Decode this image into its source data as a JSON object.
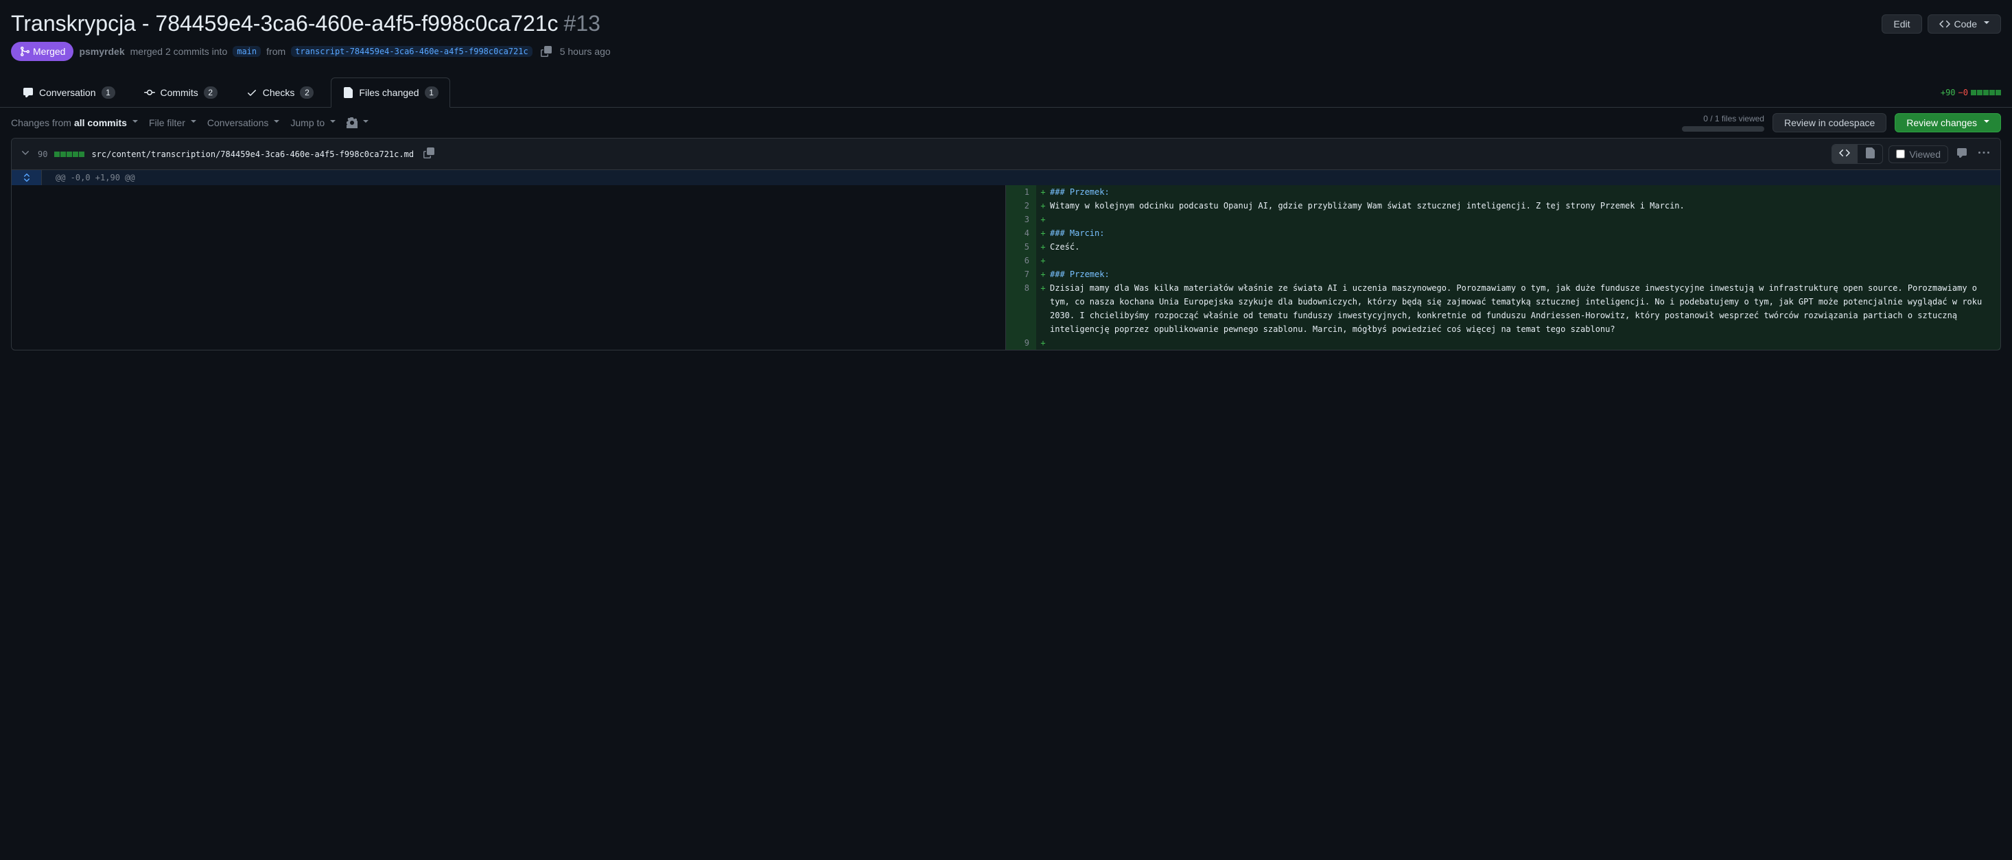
{
  "pr": {
    "title": "Transkrypcja - 784459e4-3ca6-460e-a4f5-f998c0ca721c",
    "number": "#13",
    "state": "Merged",
    "author": "psmyrdek",
    "merge_text_1": "merged 2 commits into",
    "base_branch": "main",
    "merge_text_2": "from",
    "head_branch": "transcript-784459e4-3ca6-460e-a4f5-f998c0ca721c",
    "time_ago": "5 hours ago"
  },
  "actions": {
    "edit": "Edit",
    "code": "Code"
  },
  "tabs": {
    "conversation": {
      "label": "Conversation",
      "count": "1"
    },
    "commits": {
      "label": "Commits",
      "count": "2"
    },
    "checks": {
      "label": "Checks",
      "count": "2"
    },
    "files_changed": {
      "label": "Files changed",
      "count": "1"
    }
  },
  "diffstat": {
    "add": "+90",
    "del": "−0"
  },
  "toolbar": {
    "changes_from_prefix": "Changes from",
    "changes_from_value": "all commits",
    "file_filter": "File filter",
    "conversations": "Conversations",
    "jump_to": "Jump to",
    "progress": "0 / 1 files viewed",
    "review_codespace": "Review in codespace",
    "review_changes": "Review changes"
  },
  "file": {
    "changed_lines": "90",
    "path": "src/content/transcription/784459e4-3ca6-460e-a4f5-f998c0ca721c.md",
    "viewed_label": "Viewed",
    "hunk": "@@ -0,0 +1,90 @@"
  },
  "diff_lines": [
    {
      "n": "1",
      "t": "### Przemek:",
      "heading": true
    },
    {
      "n": "2",
      "t": "Witamy w kolejnym odcinku podcastu Opanuj AI, gdzie przybliżamy Wam świat sztucznej inteligencji. Z tej strony Przemek i Marcin."
    },
    {
      "n": "3",
      "t": ""
    },
    {
      "n": "4",
      "t": "### Marcin:",
      "heading": true
    },
    {
      "n": "5",
      "t": "Cześć."
    },
    {
      "n": "6",
      "t": ""
    },
    {
      "n": "7",
      "t": "### Przemek:",
      "heading": true
    },
    {
      "n": "8",
      "t": "Dzisiaj mamy dla Was kilka materiałów właśnie ze świata AI i uczenia maszynowego. Porozmawiamy o tym, jak duże fundusze inwestycyjne inwestują w infrastrukturę open source. Porozmawiamy o tym, co nasza kochana Unia Europejska szykuje dla budowniczych, którzy będą się zajmować tematyką sztucznej inteligencji. No i podebatujemy o tym, jak GPT może potencjalnie wyglądać w roku 2030. I chcielibyśmy rozpocząć właśnie od tematu funduszy inwestycyjnych, konkretnie od funduszu Andriessen-Horowitz, który postanowił wesprzeć twórców rozwiązania partiach o sztuczną inteligencję poprzez opublikowanie pewnego szablonu. Marcin, mógłbyś powiedzieć coś więcej na temat tego szablonu?"
    },
    {
      "n": "9",
      "t": ""
    }
  ]
}
